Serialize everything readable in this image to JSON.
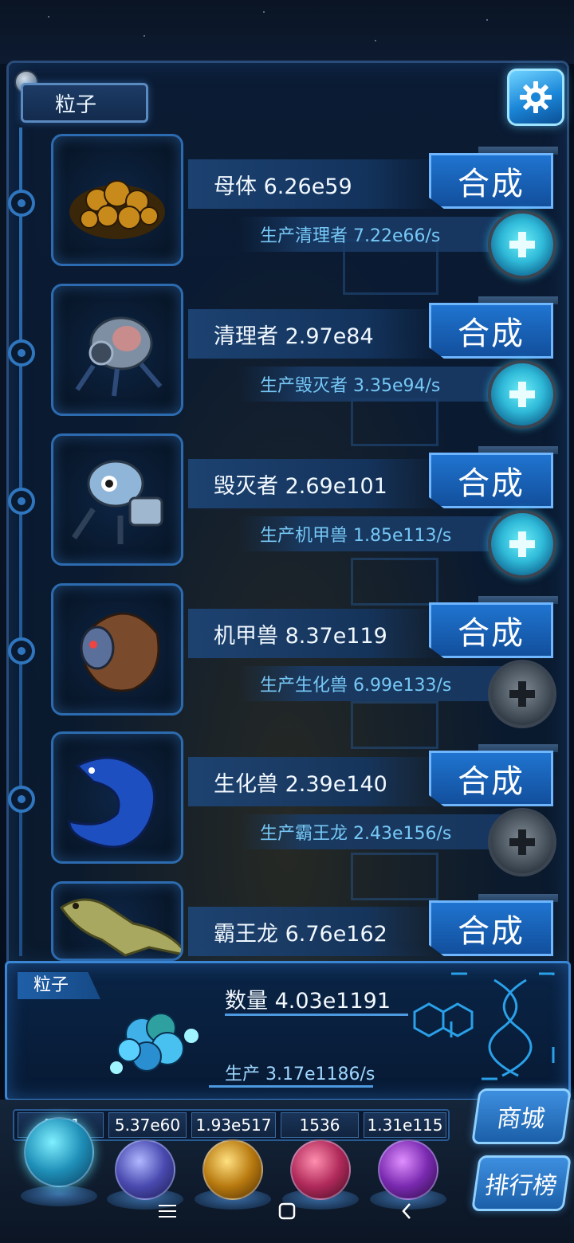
{
  "header": {
    "tab_label": "粒子"
  },
  "creatures": [
    {
      "name": "母体 6.26e59",
      "merge_label": "合成",
      "production": "生产清理者 7.22e66/s",
      "upgrade_available": true,
      "portrait": "rock-pile"
    },
    {
      "name": "清理者 2.97e84",
      "merge_label": "合成",
      "production": "生产毁灭者 3.35e94/s",
      "upgrade_available": true,
      "portrait": "brain-robot"
    },
    {
      "name": "毁灭者 2.69e101",
      "merge_label": "合成",
      "production": "生产机甲兽 1.85e113/s",
      "upgrade_available": true,
      "portrait": "gatling-robot"
    },
    {
      "name": "机甲兽 8.37e119",
      "merge_label": "合成",
      "production": "生产生化兽 6.99e133/s",
      "upgrade_available": false,
      "portrait": "mech-beast"
    },
    {
      "name": "生化兽 2.39e140",
      "merge_label": "合成",
      "production": "生产霸王龙 2.43e156/s",
      "upgrade_available": false,
      "portrait": "blue-dragon"
    },
    {
      "name": "霸王龙 6.76e162",
      "merge_label": "合成",
      "portrait": "t-rex"
    }
  ],
  "info": {
    "tag": "粒子",
    "count": "数量 4.03e1191",
    "rate": "生产 3.17e1186/s"
  },
  "resources": [
    "4.    91",
    "5.37e60",
    "1.93e517",
    "1536",
    "1.31e115"
  ],
  "side_buttons": {
    "shop": "商城",
    "rank": "排行榜"
  },
  "colors": {
    "accent": "#1f74d0",
    "plus_active": "#2fb9d8",
    "text_cyan": "#76c8f6"
  }
}
